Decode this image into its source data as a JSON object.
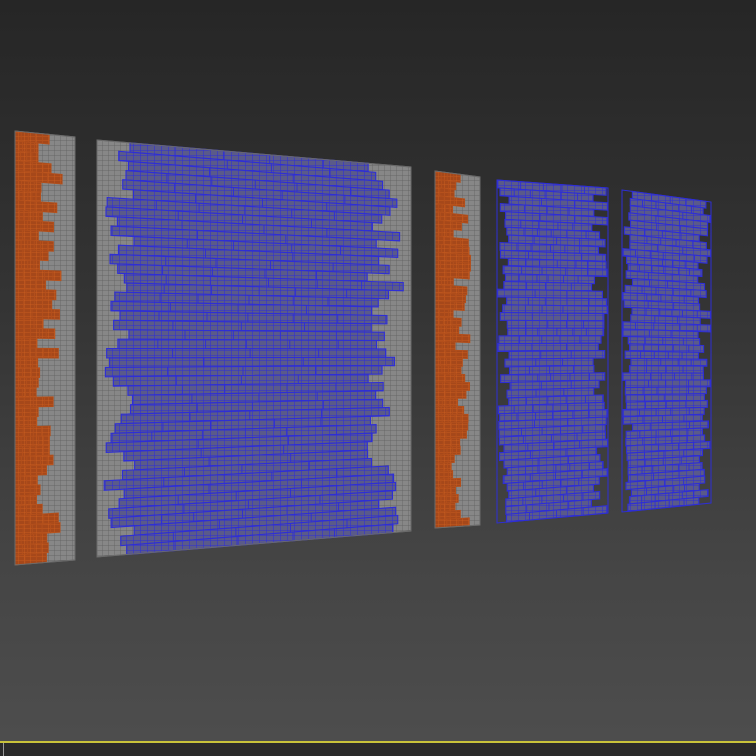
{
  "viewport": {
    "background_top": "#262626",
    "background_bottom": "#4e4e4e",
    "render_mode": "wireframe-over-shaded"
  },
  "colors": {
    "selected_wire": "#2e2ed6",
    "orange_wire": "#b4501c",
    "gray_panel": "#8c8c8c",
    "gray_wire": "#6a6a6a",
    "timeline_accent": "#c8c23a"
  },
  "panels": [
    {
      "id": "panel-1",
      "style": "orange-gray"
    },
    {
      "id": "panel-2",
      "style": "blue-on-gray"
    },
    {
      "id": "panel-3",
      "style": "orange-gray"
    },
    {
      "id": "panel-4",
      "style": "blue-only"
    },
    {
      "id": "panel-5",
      "style": "blue-only"
    }
  ]
}
